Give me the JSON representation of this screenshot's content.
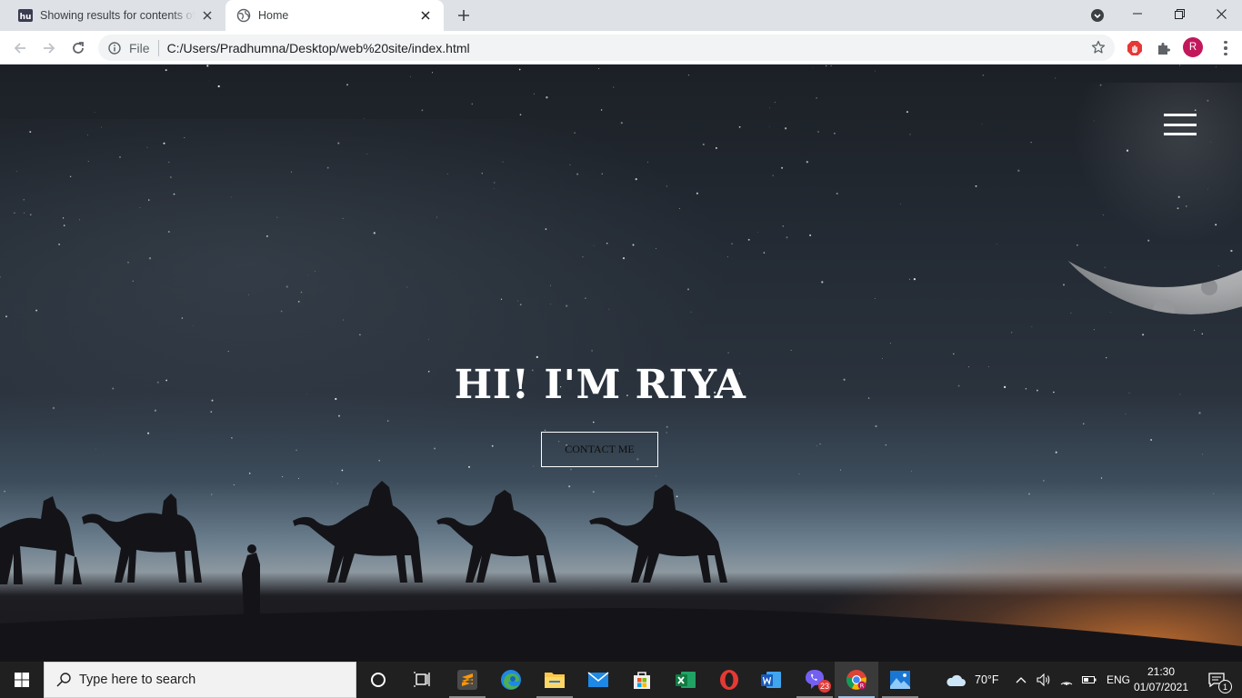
{
  "browser": {
    "tabs": [
      {
        "title": "Showing results for contents of t",
        "icon": "hn-logo-icon",
        "active": false
      },
      {
        "title": "Home",
        "icon": "globe-icon",
        "active": true
      }
    ],
    "address": {
      "scheme_label": "File",
      "url": "C:/Users/Pradhumna/Desktop/web%20site/index.html"
    },
    "profile_initial": "R"
  },
  "page": {
    "hero_title": "HI! I'M RIYA",
    "contact_label": "CONTACT ME",
    "menu_icon": "hamburger-menu-icon"
  },
  "taskbar": {
    "search_placeholder": "Type here to search",
    "apps": [
      {
        "name": "cortana",
        "icon": "cortana-circle-icon"
      },
      {
        "name": "task-view",
        "icon": "task-view-icon"
      },
      {
        "name": "sublime-text",
        "icon": "sublime-text-icon"
      },
      {
        "name": "edge",
        "icon": "edge-icon"
      },
      {
        "name": "file-explorer",
        "icon": "folder-icon"
      },
      {
        "name": "mail",
        "icon": "mail-icon"
      },
      {
        "name": "store",
        "icon": "store-icon"
      },
      {
        "name": "excel",
        "icon": "excel-icon"
      },
      {
        "name": "opera",
        "icon": "opera-icon"
      },
      {
        "name": "word",
        "icon": "word-icon"
      },
      {
        "name": "viber",
        "icon": "viber-icon",
        "badge": "23"
      },
      {
        "name": "chrome",
        "icon": "chrome-icon"
      },
      {
        "name": "photos",
        "icon": "photos-icon"
      }
    ],
    "weather": "70°F",
    "language": "ENG",
    "time": "21:30",
    "date": "01/07/2021",
    "notification_count": "1"
  },
  "colors": {
    "tabstrip_bg": "#dee1e6",
    "taskbar_bg": "#202020",
    "profile_bg": "#c2185b",
    "sunset_glow": "#d67832"
  }
}
